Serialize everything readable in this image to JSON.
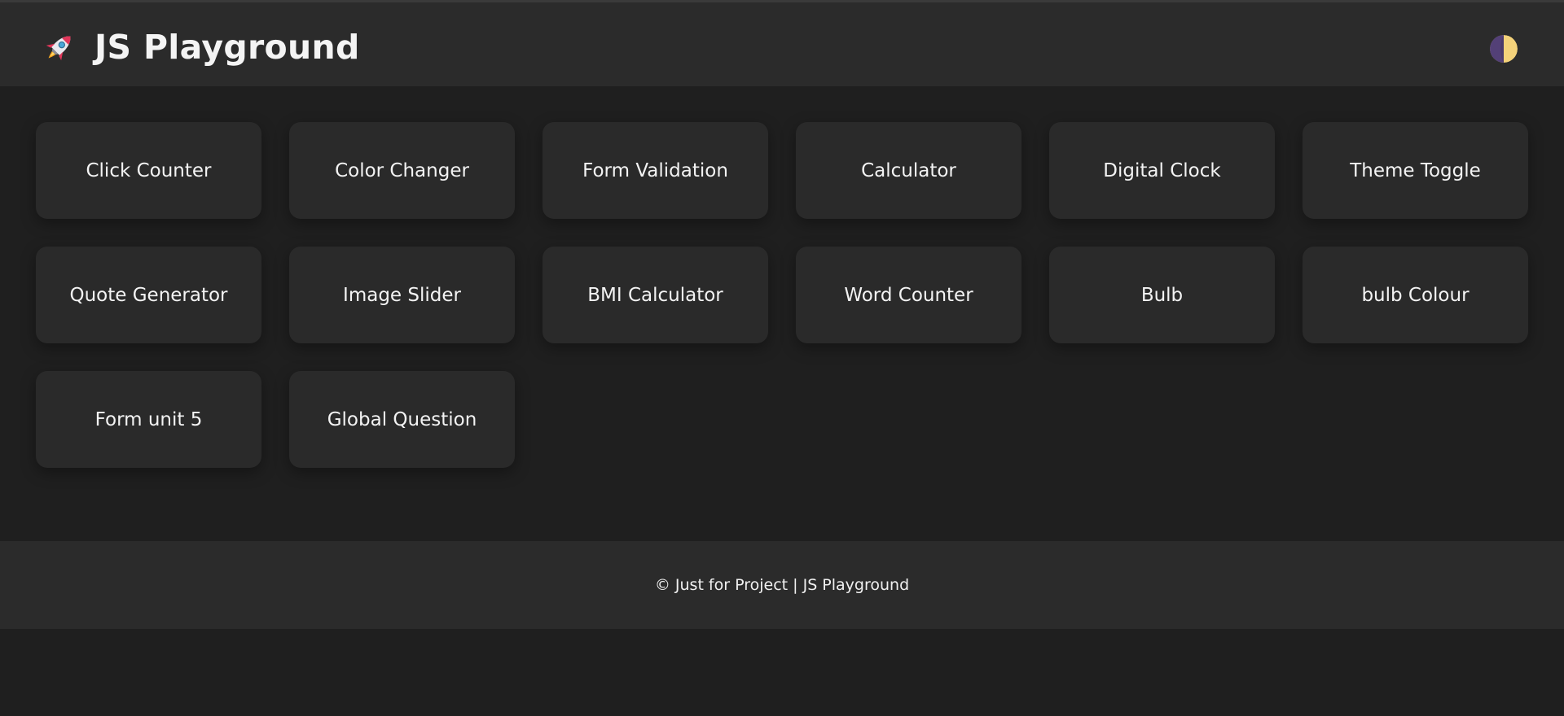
{
  "header": {
    "icon": "rocket-icon",
    "title": "JS Playground",
    "theme_toggle_icon": "half-moon-icon"
  },
  "projects": [
    {
      "label": "Click Counter"
    },
    {
      "label": "Color Changer"
    },
    {
      "label": "Form Validation"
    },
    {
      "label": "Calculator"
    },
    {
      "label": "Digital Clock"
    },
    {
      "label": "Theme Toggle"
    },
    {
      "label": "Quote Generator"
    },
    {
      "label": "Image Slider"
    },
    {
      "label": "BMI Calculator"
    },
    {
      "label": "Word Counter"
    },
    {
      "label": "Bulb"
    },
    {
      "label": "bulb Colour"
    },
    {
      "label": "Form unit 5"
    },
    {
      "label": "Global Question"
    }
  ],
  "footer": {
    "text": "© Just for Project | JS Playground"
  },
  "colors": {
    "background": "#1f1f1f",
    "header_bg": "#2b2b2b",
    "card_bg": "#2a2a2a",
    "text": "#f3f3f3",
    "toggle_dark": "#4a3a6a",
    "toggle_light": "#f4d27a"
  }
}
